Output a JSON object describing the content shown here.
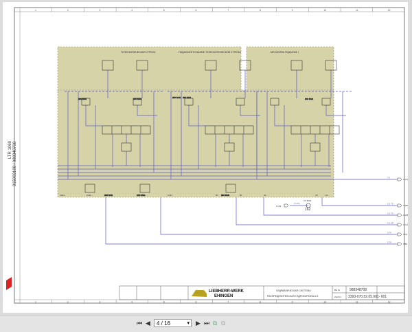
{
  "document": {
    "side_model": "LTR 1060",
    "side_ids": "915903108  /  988348708",
    "sections": [
      "ТЕЛЕСКОПИЧЕСКАЯ СТРЕЛА",
      "ПОДЪЕМ/ОПУСКАНИЕ ТЕЛЕСКОПИЧЕСКОЙ СТРЕЛЫ",
      "МЕХАНИЗМ ПОДЪЕМА І"
    ],
    "pressure_labels": [
      "250 BAR",
      "100 BAR",
      "250 BAR",
      "250 BAR",
      "100 BAR",
      "280 BAR",
      "115 BAR",
      "290 BAR",
      "3.5 BAR"
    ],
    "ports": [
      "KL82",
      "KL92",
      "A2",
      "KL93",
      "B1",
      "A3",
      "A1",
      "A5",
      "B3"
    ],
    "component_id": "162",
    "outputs": [
      {
        "line": "TS",
        "target": "Л-2/16"
      },
      {
        "line": "5.2 TS",
        "target": "Л-8/6"
      },
      {
        "line": "5.2 TS",
        "target": "Л-9/8"
      },
      {
        "line": "5.2 MP",
        "target": "Л-C/2"
      },
      {
        "line": "5.TK",
        "target": "7/C2"
      },
      {
        "line": "5.TK",
        "target": "7/B2"
      }
    ],
    "input": {
      "line": "2 HTS",
      "source": "Л-4/3"
    },
    "columns": [
      "1",
      "2",
      "3",
      "4",
      "5",
      "6",
      "7",
      "8",
      "9",
      "10",
      "11",
      "12"
    ],
    "title_block": {
      "brand_line1": "LIEBHERR-WERK",
      "brand_line2": "EHINGEN",
      "title_line1": "ГИДРАВЛИЧЕСКАЯ СИСТЕМА",
      "title_line2": "РАСПРЕДЕЛИТЕЛЬНАЯ ГИДРОКОРОБКА LS",
      "number_label": "Вм.Nr.",
      "number": "988348708",
      "drawing_label": "Zeichnr.",
      "drawing_number": "3393-070.52.05.001- 001"
    }
  },
  "viewer": {
    "page_value": "4 / 16",
    "first_icon": "first-page-icon",
    "prev_icon": "prev-page-icon",
    "next_icon": "next-page-icon",
    "last_icon": "last-page-icon"
  },
  "colors": {
    "fill": "#d6d3a8",
    "line": "#5a5ac8",
    "ink": "#333333"
  }
}
